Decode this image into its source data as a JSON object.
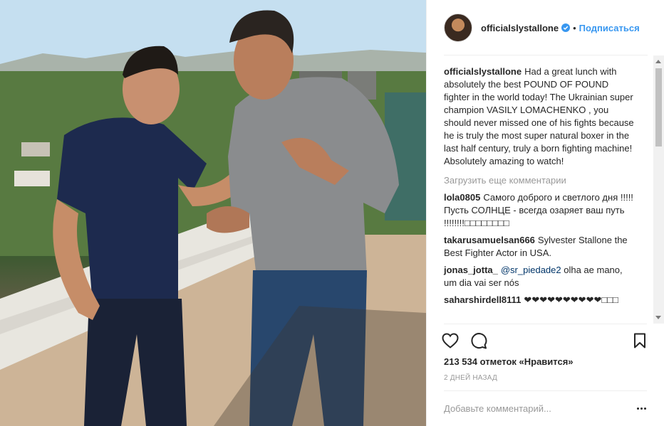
{
  "post": {
    "username": "officialslystallone",
    "separator": "•",
    "follow_label": "Подписаться",
    "caption": "Had a great lunch with absolutely the best POUND OF POUND fighter in the world today! The Ukrainian super champion VASILY LOMACHENKO , you should never missed one of his fights because he is truly the most super natural boxer in the last half century, truly a born fighting machine! Absolutely amazing to watch!",
    "load_more": "Загрузить еще комментарии",
    "comments": [
      {
        "user": "lola0805",
        "text": "Самого доброго и светлого дня !!!!! Пусть СОЛНЦЕ - всегда озаряет ваш путь !!!!!!!!□□□□□□□□"
      },
      {
        "user": "takarusamuelsan666",
        "text": "Sylvester Stallone the Best Fighter Actor in USA."
      },
      {
        "user": "jonas_jotta_",
        "mention": "@sr_piedade2",
        "text": " olha ae mano, um dia vai ser nós"
      },
      {
        "user": "saharshirdell8111",
        "text": "❤❤❤❤❤❤❤❤❤❤□□□"
      }
    ],
    "likes": "213 534 отметок «Нравится»",
    "time_ago": "2 ДНЕЙ НАЗАД",
    "add_comment_placeholder": "Добавьте комментарий..."
  },
  "icons": {
    "verified": "verified-badge-icon",
    "like": "heart-icon",
    "comment": "speech-bubble-icon",
    "save": "bookmark-icon",
    "more": "ellipsis-icon"
  },
  "colors": {
    "link_blue": "#3897f0",
    "text": "#262626",
    "muted": "#999999",
    "divider": "#efefef"
  }
}
